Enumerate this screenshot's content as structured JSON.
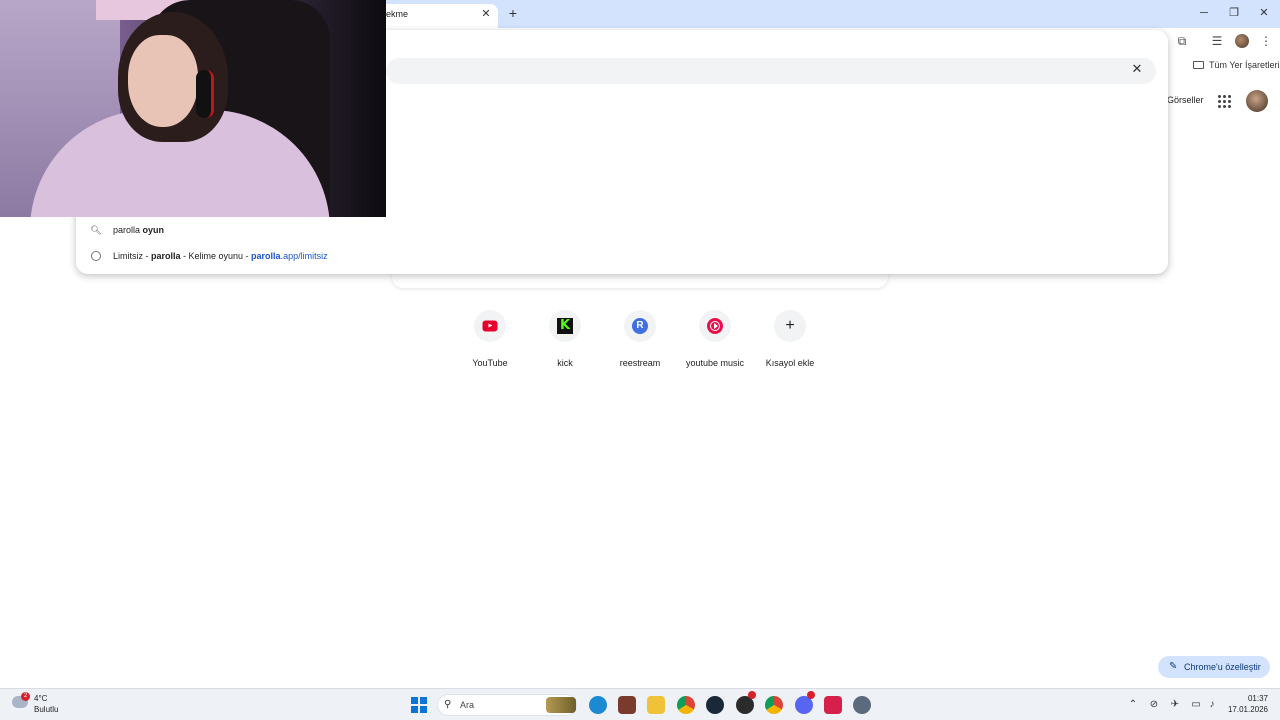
{
  "browser": {
    "tab_title": "ekme",
    "bookmarks_all_label": "Tüm Yer İşaretleri"
  },
  "omnibox": {
    "suggestions": [
      {
        "type": "search",
        "query_plain": "parolla ",
        "query_bold": "oyun"
      },
      {
        "type": "history",
        "prefix": "Limitsiz - ",
        "bold": "parolla",
        "suffix": " - Kelime oyunu - ",
        "url_bold": "parolla",
        "url_rest": ".app/limitsiz"
      }
    ]
  },
  "google": {
    "images_link": "Görseller",
    "shortcuts": [
      {
        "label": "YouTube",
        "icon": "youtube-icon"
      },
      {
        "label": "kick",
        "icon": "kick-icon"
      },
      {
        "label": "reestream",
        "icon": "restream-icon",
        "glyph": "R"
      },
      {
        "label": "youtube music",
        "icon": "youtube-music-icon"
      },
      {
        "label": "Kısayol ekle",
        "icon": "plus-icon",
        "glyph": "+"
      }
    ],
    "customize_label": "Chrome'u özelleştir"
  },
  "taskbar": {
    "weather_temp": "4°C",
    "weather_desc": "Bulutlu",
    "weather_badge": "2",
    "search_placeholder": "Ara",
    "clock_time": "01:37",
    "clock_date": "17.01.2026"
  },
  "colors": {
    "tab_strip": "#d3e3fd",
    "url_blue": "#1a56c7",
    "youtube_red": "#e8002d",
    "kick_green": "#53fc18",
    "restream_blue": "#3f6fe0"
  }
}
